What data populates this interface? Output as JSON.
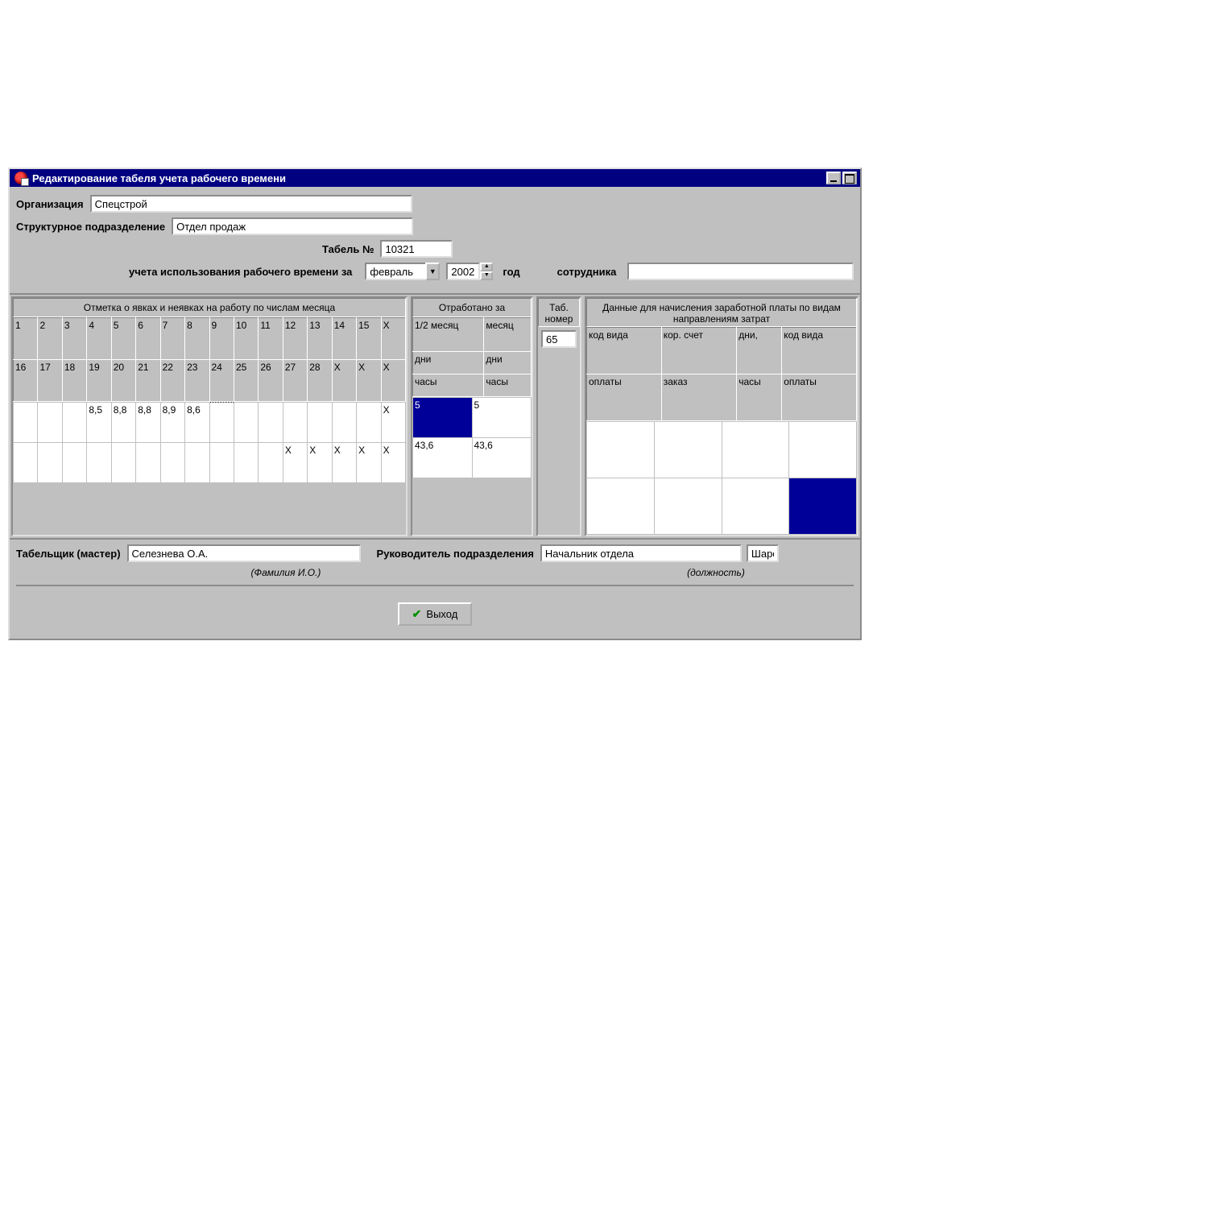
{
  "window": {
    "title": "Редактирование табеля учета рабочего времени"
  },
  "form": {
    "org_label": "Организация",
    "org_value": "Спецстрой",
    "dept_label": "Структурное подразделение",
    "dept_value": "Отдел продаж",
    "tabel_no_label": "Табель №",
    "tabel_no_value": "10321",
    "period_prefix": "учета использования рабочего времени за",
    "month_value": "февраль",
    "year_value": "2002",
    "year_label": "год",
    "employee_label": "сотрудника",
    "employee_value": ""
  },
  "sections": {
    "attendance": "Отметка о явках и неявках на работу по числам месяца",
    "worked": "Отработано за",
    "tabno": "Таб. номер",
    "payroll": "Данные для начисления заработной платы по видам направлениям затрат"
  },
  "days_row1": [
    "1",
    "2",
    "3",
    "4",
    "5",
    "6",
    "7",
    "8",
    "9",
    "10",
    "11",
    "12",
    "13",
    "14",
    "15",
    "X"
  ],
  "days_row2": [
    "16",
    "17",
    "18",
    "19",
    "20",
    "21",
    "22",
    "23",
    "24",
    "25",
    "26",
    "27",
    "28",
    "X",
    "X",
    "X"
  ],
  "attend_r1": [
    "",
    "",
    "",
    "8,5",
    "8,8",
    "8,8",
    "8,9",
    "8,6",
    "",
    "",
    "",
    "",
    "",
    "",
    "",
    "X"
  ],
  "attend_r2": [
    "",
    "",
    "",
    "",
    "",
    "",
    "",
    "",
    "",
    "",
    "",
    "X",
    "X",
    "X",
    "X",
    "X"
  ],
  "worked": {
    "half_label": "1/2 месяц",
    "month_label": "месяц",
    "days_label": "дни",
    "hours_label": "часы",
    "half_days": "5",
    "month_days": "5",
    "half_hours": "43,6",
    "month_hours": "43,6"
  },
  "tabno_value": "65",
  "pay_headers": {
    "r1c1": "код вида",
    "r1c2": "кор. счет",
    "r1c3": "дни,",
    "r1c4": "код вида",
    "r2c1": "оплаты",
    "r2c2": "заказ",
    "r2c3": "часы",
    "r2c4": "оплаты"
  },
  "footer": {
    "clerk_label": "Табельщик (мастер)",
    "clerk_value": "Селезнева О.А.",
    "clerk_hint": "(Фамилия И.О.)",
    "head_label": "Руководитель подразделения",
    "head_pos_value": "Начальник отдела",
    "head_pos_hint": "(должность)",
    "head_name_value": "Шаро",
    "exit_label": "Выход"
  }
}
